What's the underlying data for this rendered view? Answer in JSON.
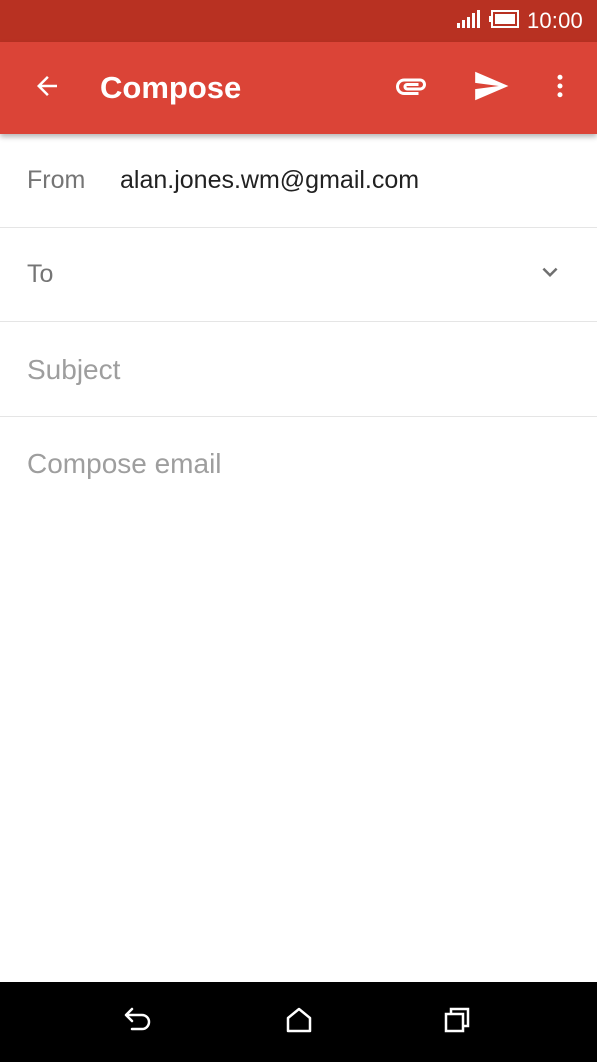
{
  "status_bar": {
    "time": "10:00",
    "icons": [
      "signal-icon",
      "battery-icon"
    ]
  },
  "app_bar": {
    "title": "Compose",
    "background": "#db4437",
    "status_background": "#b83122",
    "icons": [
      "back-arrow-icon",
      "paperclip-icon",
      "send-icon",
      "more-vert-icon"
    ]
  },
  "compose": {
    "from_label": "From",
    "from_value": "alan.jones.wm@gmail.com",
    "to_label": "To",
    "to_value": "",
    "subject_placeholder": "Subject",
    "subject_value": "",
    "body_placeholder": "Compose email",
    "body_value": ""
  },
  "nav_bar": {
    "icons": [
      "nav-back-icon",
      "nav-home-icon",
      "nav-recents-icon"
    ]
  }
}
